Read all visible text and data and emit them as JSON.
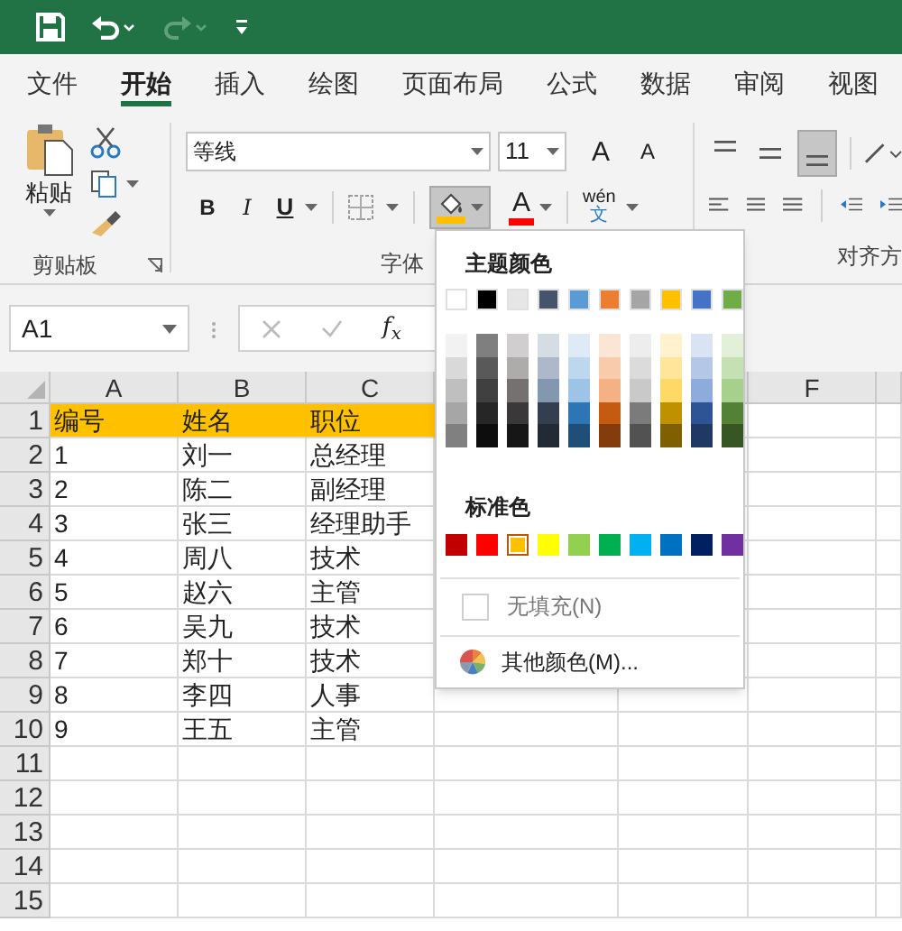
{
  "tabs": [
    {
      "label": "文件",
      "selected": false
    },
    {
      "label": "开始",
      "selected": true
    },
    {
      "label": "插入",
      "selected": false
    },
    {
      "label": "绘图",
      "selected": false
    },
    {
      "label": "页面布局",
      "selected": false
    },
    {
      "label": "公式",
      "selected": false
    },
    {
      "label": "数据",
      "selected": false
    },
    {
      "label": "审阅",
      "selected": false
    },
    {
      "label": "视图",
      "selected": false
    }
  ],
  "ribbon": {
    "paste_label": "粘贴",
    "font_name": "等线",
    "font_size": "11",
    "grow_font": "A",
    "shrink_font": "A",
    "bold": "B",
    "italic": "I",
    "underline": "U",
    "fill_button": {
      "pressed": true
    },
    "font_color": "A",
    "phonetic": {
      "pinyin": "wén",
      "character": "文"
    },
    "vertical_align": [
      {
        "selected": false
      },
      {
        "selected": false
      },
      {
        "selected": true
      }
    ],
    "groups": [
      "剪贴板",
      "字体",
      "对齐方"
    ]
  },
  "formula_bar": {
    "name_box": "A1",
    "function_label": "f$_{x}$"
  },
  "sheet": {
    "columns_left": [
      "A",
      "B",
      "C"
    ],
    "columns_right": [
      "F"
    ],
    "rows": [
      {
        "number": "1",
        "cells": [
          "编号",
          "姓名",
          "职位"
        ],
        "highlighted": true
      },
      {
        "number": "2",
        "cells": [
          "1",
          "刘一",
          "总经理"
        ],
        "highlighted": false
      },
      {
        "number": "3",
        "cells": [
          "2",
          "陈二",
          "副经理"
        ],
        "highlighted": false
      },
      {
        "number": "4",
        "cells": [
          "3",
          "张三",
          "经理助手"
        ],
        "highlighted": false
      },
      {
        "number": "5",
        "cells": [
          "4",
          "周八",
          "技术"
        ],
        "highlighted": false
      },
      {
        "number": "6",
        "cells": [
          "5",
          "赵六",
          "主管"
        ],
        "highlighted": false
      },
      {
        "number": "7",
        "cells": [
          "6",
          "吴九",
          "技术"
        ],
        "highlighted": false
      },
      {
        "number": "8",
        "cells": [
          "7",
          "郑十",
          "技术"
        ],
        "highlighted": false
      },
      {
        "number": "9",
        "cells": [
          "8",
          "李四",
          "人事"
        ],
        "highlighted": false
      },
      {
        "number": "10",
        "cells": [
          "9",
          "王五",
          "主管"
        ],
        "highlighted": false
      },
      {
        "number": "11",
        "cells": [],
        "highlighted": false
      },
      {
        "number": "12",
        "cells": [],
        "highlighted": false
      },
      {
        "number": "13",
        "cells": [],
        "highlighted": false
      },
      {
        "number": "14",
        "cells": [],
        "highlighted": false
      },
      {
        "number": "15",
        "cells": [],
        "highlighted": false
      }
    ]
  },
  "fill_menu": {
    "theme_title": "主题颜色",
    "theme_colors": [
      {
        "color": "#ffffff",
        "shades": [
          {
            "color": "#f2f2f2"
          },
          {
            "color": "#d9d9d9"
          },
          {
            "color": "#bfbfbf"
          },
          {
            "color": "#a6a6a6"
          },
          {
            "color": "#808080"
          }
        ]
      },
      {
        "color": "#000000",
        "shades": [
          {
            "color": "#7f7f7f"
          },
          {
            "color": "#595959"
          },
          {
            "color": "#404040"
          },
          {
            "color": "#262626"
          },
          {
            "color": "#0d0d0d"
          }
        ]
      },
      {
        "color": "#e7e6e6",
        "shades": [
          {
            "color": "#d0cece"
          },
          {
            "color": "#aeabab"
          },
          {
            "color": "#757171"
          },
          {
            "color": "#3a3838"
          },
          {
            "color": "#171616"
          }
        ]
      },
      {
        "color": "#44546a",
        "shades": [
          {
            "color": "#d6dce4"
          },
          {
            "color": "#adb9ca"
          },
          {
            "color": "#8497b0"
          },
          {
            "color": "#333f4f"
          },
          {
            "color": "#222a35"
          }
        ]
      },
      {
        "color": "#5b9bd5",
        "shades": [
          {
            "color": "#deebf6"
          },
          {
            "color": "#bdd7ee"
          },
          {
            "color": "#9dc3e6"
          },
          {
            "color": "#2e75b5"
          },
          {
            "color": "#1f4e79"
          }
        ]
      },
      {
        "color": "#ed7d31",
        "shades": [
          {
            "color": "#fbe5d5"
          },
          {
            "color": "#f7cbac"
          },
          {
            "color": "#f4b183"
          },
          {
            "color": "#c55a11"
          },
          {
            "color": "#833c0b"
          }
        ]
      },
      {
        "color": "#a5a5a5",
        "shades": [
          {
            "color": "#ededed"
          },
          {
            "color": "#dbdbdb"
          },
          {
            "color": "#c9c9c9"
          },
          {
            "color": "#7b7b7b"
          },
          {
            "color": "#525252"
          }
        ]
      },
      {
        "color": "#ffc000",
        "shades": [
          {
            "color": "#fff2cc"
          },
          {
            "color": "#fee599"
          },
          {
            "color": "#ffd965"
          },
          {
            "color": "#bf9000"
          },
          {
            "color": "#7f6000"
          }
        ]
      },
      {
        "color": "#4472c4",
        "shades": [
          {
            "color": "#dae3f3"
          },
          {
            "color": "#b4c7e7"
          },
          {
            "color": "#8faadc"
          },
          {
            "color": "#2f5496"
          },
          {
            "color": "#1f3864"
          }
        ]
      },
      {
        "color": "#70ad47",
        "shades": [
          {
            "color": "#e2efd9"
          },
          {
            "color": "#c5e0b3"
          },
          {
            "color": "#a8d08d"
          },
          {
            "color": "#538135"
          },
          {
            "color": "#375623"
          }
        ]
      }
    ],
    "standard_title": "标准色",
    "standard_colors": [
      {
        "color": "#c00000",
        "selected": false
      },
      {
        "color": "#ff0000",
        "selected": false
      },
      {
        "color": "#ffc000",
        "selected": true
      },
      {
        "color": "#ffff00",
        "selected": false
      },
      {
        "color": "#92d050",
        "selected": false
      },
      {
        "color": "#00b050",
        "selected": false
      },
      {
        "color": "#00b0f0",
        "selected": false
      },
      {
        "color": "#0070c0",
        "selected": false
      },
      {
        "color": "#002060",
        "selected": false
      },
      {
        "color": "#7030a0",
        "selected": false
      }
    ],
    "no_fill": "无填充(N)",
    "more_colors": "其他颜色(M)..."
  }
}
